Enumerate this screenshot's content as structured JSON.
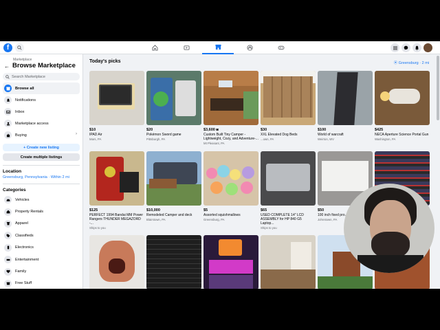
{
  "topbar": {
    "logo_letter": "f",
    "nav_icons": [
      "home-icon",
      "video-icon",
      "marketplace-icon",
      "groups-icon",
      "gaming-icon"
    ]
  },
  "sidebar": {
    "breadcrumb": "Marketplace",
    "title": "Browse Marketplace",
    "search_placeholder": "Search Marketplace",
    "nav_items": [
      {
        "label": "Browse all",
        "icon": "storefront-icon",
        "active": true
      },
      {
        "label": "Notifications",
        "icon": "bell-icon"
      },
      {
        "label": "Inbox",
        "icon": "inbox-icon"
      },
      {
        "label": "Marketplace access",
        "icon": "person-icon"
      },
      {
        "label": "Buying",
        "icon": "bag-icon",
        "chevron": true
      }
    ],
    "create_listing": "+ Create new listing",
    "create_multiple": "Create multiple listings",
    "location_heading": "Location",
    "location_value": "Greensburg, Pennsylvania · Within 2 mi",
    "categories_heading": "Categories",
    "categories": [
      {
        "label": "Vehicles",
        "icon": "car-icon"
      },
      {
        "label": "Property Rentals",
        "icon": "house-icon"
      },
      {
        "label": "Apparel",
        "icon": "shirt-icon"
      },
      {
        "label": "Classifieds",
        "icon": "tag-icon"
      },
      {
        "label": "Electronics",
        "icon": "phone-icon"
      },
      {
        "label": "Entertainment",
        "icon": "ticket-icon"
      },
      {
        "label": "Family",
        "icon": "heart-icon"
      },
      {
        "label": "Free Stuff",
        "icon": "gift-icon"
      }
    ]
  },
  "main": {
    "title": "Today's picks",
    "location": "Greensburg · 2 mi",
    "listings": [
      {
        "price": "$10",
        "title": "IPAD Air",
        "location": "Mars, PA"
      },
      {
        "price": "$20",
        "title": "Pokémon Sword game",
        "location": "Pittsburgh, PA"
      },
      {
        "price": "$3,600",
        "title": "Custom Built Tiny Camper - Lightweight, Cozy, and Adventure-...",
        "location": "Mt Pleasant, PA"
      },
      {
        "price": "$30",
        "title": "XXL Elevated Dog Beds",
        "location": "...own, PA"
      },
      {
        "price": "$100",
        "title": "World of warcraft",
        "location": "Weirton, WV"
      },
      {
        "price": "$425",
        "title": "NECA Aperture Science Portal Gun",
        "location": "Washington, PA"
      },
      {
        "price": "$125",
        "title": "PERFECT 1994 Bandai MM Power Rangers THUNDER MEGAZORD -...",
        "location": "Ships to you"
      },
      {
        "price": "$10,000",
        "title": "Remodeled Camper and deck",
        "location": "Blairstown, PA"
      },
      {
        "price": "$5",
        "title": "Assorted squishmallows",
        "location": "Greensburg, PA"
      },
      {
        "price": "$65",
        "title": "USED COMPLETE 14\" LCD ASSEMBLY for HP 840 G5 Laptop...",
        "location": "Ships to you"
      },
      {
        "price": "$50",
        "title": "100 inch fixed pro...",
        "location": "Johnstown, PA"
      },
      {
        "price": "",
        "title": "",
        "location": ""
      }
    ]
  }
}
